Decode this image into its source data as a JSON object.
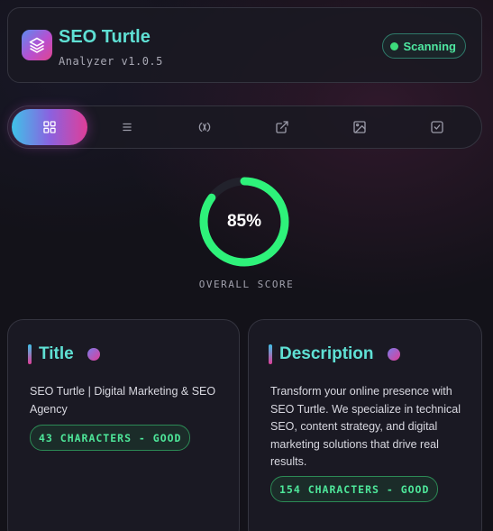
{
  "app": {
    "title": "SEO Turtle",
    "version": "Analyzer v1.0.5",
    "status": "Scanning",
    "logo_icon": "layers-icon"
  },
  "tabs": [
    {
      "icon": "grid-icon",
      "active": true
    },
    {
      "icon": "list-icon",
      "active": false
    },
    {
      "icon": "links-icon",
      "active": false
    },
    {
      "icon": "external-link-icon",
      "active": false
    },
    {
      "icon": "image-icon",
      "active": false
    },
    {
      "icon": "checkbox-icon",
      "active": false
    }
  ],
  "score": {
    "value": "85%",
    "fraction": 0.85,
    "label": "OVERALL SCORE"
  },
  "cards": {
    "title": {
      "heading": "Title",
      "text": "SEO Turtle | Digital Marketing & SEO Agency",
      "badge": "43 CHARACTERS - GOOD"
    },
    "description": {
      "heading": "Description",
      "text": "Transform your online presence with SEO Turtle. We specialize in technical SEO, content strategy, and digital marketing solutions that drive real results.",
      "badge": "154 CHARACTERS - GOOD"
    }
  },
  "colors": {
    "accent": "#5fe0d4",
    "good": "#4ee79a",
    "score_ring": "#2ef27a",
    "gradient_start": "#3fc2e8",
    "gradient_end": "#df3e98"
  }
}
